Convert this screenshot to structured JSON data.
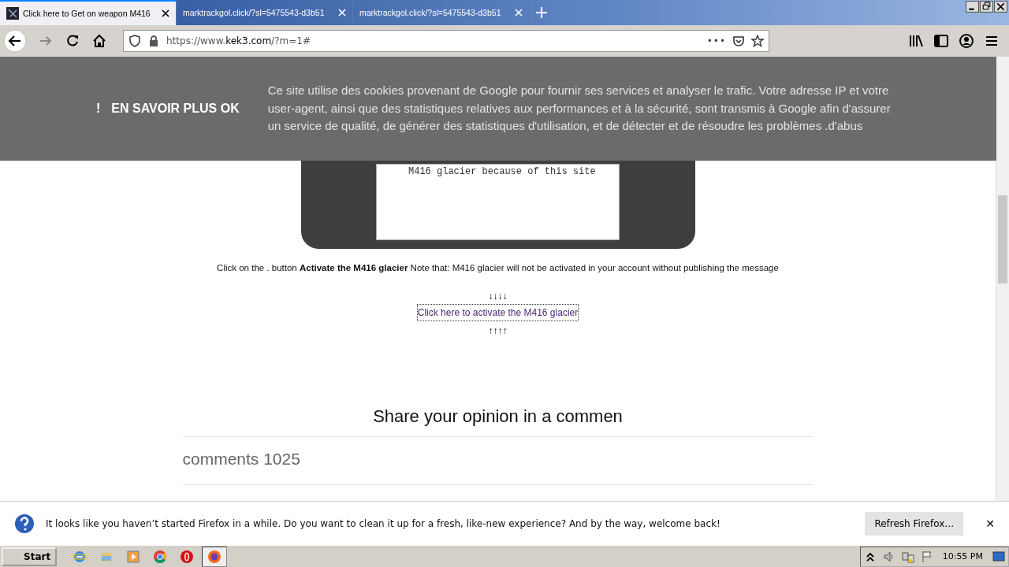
{
  "tabs": [
    {
      "title": "Click here to Get on weapon M416",
      "selected": true
    },
    {
      "title": "marktrackgol.click/?sl=5475543-d3b51",
      "selected": false
    },
    {
      "title": "marktrackgol.click/?sl=5475543-d3b51",
      "selected": false
    }
  ],
  "address_bar": {
    "url_prefix": "https://www.",
    "url_domain": "kek3.com",
    "url_suffix": "/?m=1#",
    "more": "•••"
  },
  "cookie_banner": {
    "mark": "!",
    "button": "EN SAVOIR PLUS OK",
    "text": "Ce site utilise des cookies provenant de Google pour fournir ses services et analyser le trafic. Votre adresse IP et votre user-agent, ainsi que des statistiques relatives aux performances et à la sécurité, sont transmis à Google afin d'assurer un service de qualité, de générer des statistiques d'utilisation, et de détecter et de résoudre les problèmes .d'abus"
  },
  "page": {
    "textarea_value": "M416 glacier because of this site",
    "instruction": "Click on the . button **Activate the M416 glacier** Note that: M416 glacier will not be activated in your account without publishing the message",
    "arrows_down": "↓↓↓↓",
    "link": "Click here to activate the M416 glacier",
    "arrows_up": "↑↑↑↑",
    "heading": "Share your opinion in a commen",
    "comments": "comments 1025"
  },
  "notification": {
    "text": "It looks like you haven’t started Firefox in a while. Do you want to clean it up for a fresh, like-new experience? And by the way, welcome back!",
    "button": "Refresh Firefox…",
    "close": "✕"
  },
  "taskbar": {
    "start": "Start",
    "apps": [
      {
        "kind": "ie",
        "selected": false
      },
      {
        "kind": "folder",
        "selected": false
      },
      {
        "kind": "media",
        "selected": false
      },
      {
        "kind": "chrome",
        "selected": false
      },
      {
        "kind": "opera",
        "selected": false
      },
      {
        "kind": "firefox",
        "selected": true
      }
    ],
    "clock": "10:55 PM"
  }
}
